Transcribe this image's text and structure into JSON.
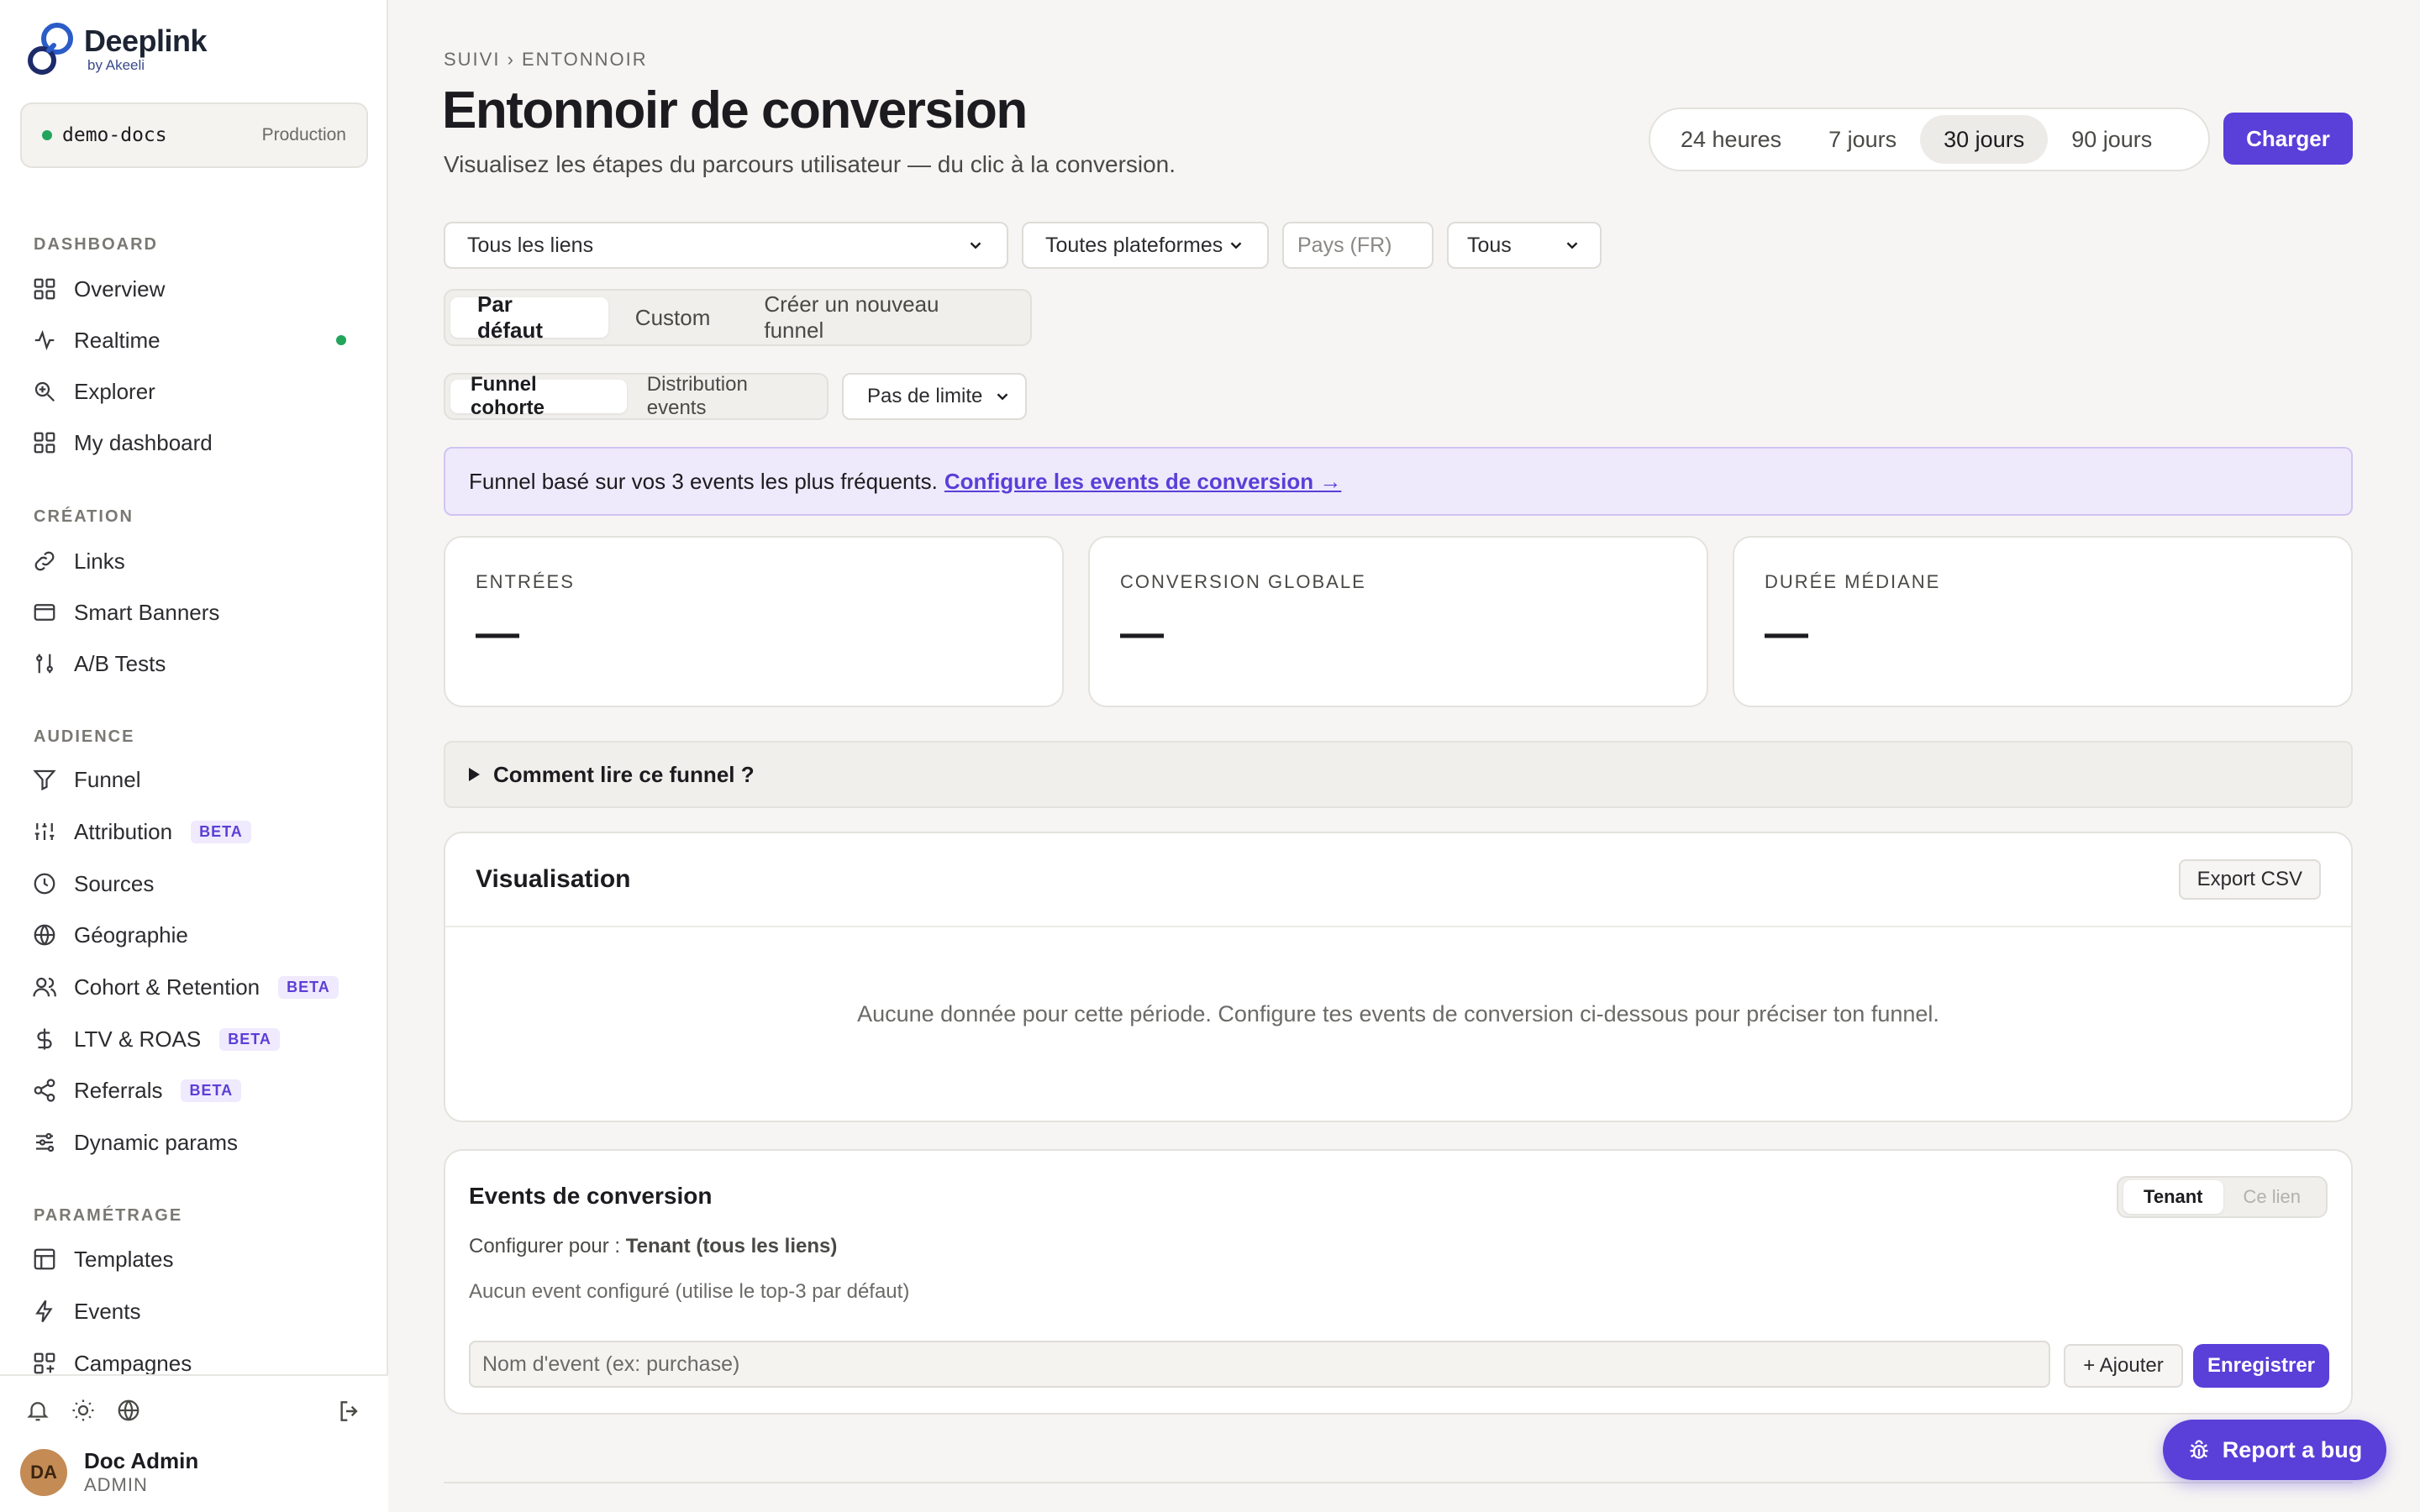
{
  "brand": {
    "name": "Deeplink",
    "sub": "by Akeeli"
  },
  "workspace": {
    "name": "demo-docs",
    "env": "Production"
  },
  "sidebar": {
    "sections": [
      {
        "label": "DASHBOARD",
        "items": [
          {
            "label": "Overview"
          },
          {
            "label": "Realtime"
          },
          {
            "label": "Explorer"
          },
          {
            "label": "My dashboard"
          }
        ]
      },
      {
        "label": "CRÉATION",
        "items": [
          {
            "label": "Links"
          },
          {
            "label": "Smart Banners"
          },
          {
            "label": "A/B Tests"
          }
        ]
      },
      {
        "label": "AUDIENCE",
        "items": [
          {
            "label": "Funnel"
          },
          {
            "label": "Attribution",
            "badge": "BETA"
          },
          {
            "label": "Sources"
          },
          {
            "label": "Géographie"
          },
          {
            "label": "Cohort & Retention",
            "badge": "BETA"
          },
          {
            "label": "LTV & ROAS",
            "badge": "BETA"
          },
          {
            "label": "Referrals",
            "badge": "BETA"
          },
          {
            "label": "Dynamic params"
          }
        ]
      },
      {
        "label": "PARAMÉTRAGE",
        "items": [
          {
            "label": "Templates"
          },
          {
            "label": "Events"
          },
          {
            "label": "Campagnes"
          }
        ]
      }
    ]
  },
  "user": {
    "initials": "DA",
    "name": "Doc Admin",
    "role": "ADMIN"
  },
  "header": {
    "breadcrumb": "SUIVI › ENTONNOIR",
    "title": "Entonnoir de conversion",
    "subtitle": "Visualisez les étapes du parcours utilisateur — du clic à la conversion.",
    "ranges": [
      "24 heures",
      "7 jours",
      "30 jours",
      "90 jours"
    ],
    "active_range": "30 jours",
    "load_label": "Charger"
  },
  "filters": {
    "links": "Tous les liens",
    "platforms": "Toutes plateformes",
    "country_placeholder": "Pays (FR)",
    "all": "Tous"
  },
  "funnel_tabs": {
    "items": [
      "Par défaut",
      "Custom",
      "Créer un nouveau funnel"
    ],
    "active": "Par défaut"
  },
  "view_tabs": {
    "items": [
      "Funnel cohorte",
      "Distribution events"
    ],
    "active": "Funnel cohorte"
  },
  "limit_select": "Pas de limite",
  "info": {
    "text": "Funnel basé sur vos 3 events les plus fréquents.",
    "link": "Configure les events de conversion →"
  },
  "kpis": [
    {
      "label": "ENTRÉES",
      "value": "—"
    },
    {
      "label": "CONVERSION GLOBALE",
      "value": "—"
    },
    {
      "label": "DURÉE MÉDIANE",
      "value": "—"
    }
  ],
  "howto": "Comment lire ce funnel ?",
  "viz": {
    "title": "Visualisation",
    "export_label": "Export CSV",
    "empty": "Aucune donnée pour cette période. Configure tes events de conversion ci-dessous pour préciser ton funnel."
  },
  "events": {
    "title": "Events de conversion",
    "toggle": [
      "Tenant",
      "Ce lien"
    ],
    "config_prefix": "Configurer pour :",
    "config_target": "Tenant (tous les liens)",
    "none": "Aucun event configuré (utilise le top-3 par défaut)",
    "input_placeholder": "Nom d'event (ex: purchase)",
    "add_label": "+ Ajouter",
    "save_label": "Enregistrer"
  },
  "bug_label": "Report a bug",
  "colors": {
    "accent": "#5a3fd8",
    "live": "#22a55b"
  }
}
